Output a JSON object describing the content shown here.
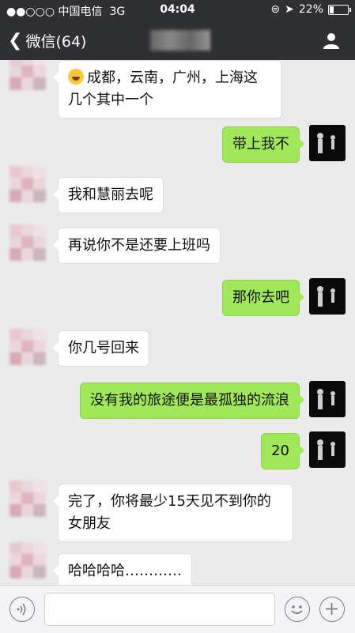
{
  "status_bar": {
    "carrier": "●●○○○ 中国电信",
    "network": "3G",
    "time": "04:04",
    "battery_percent": "22%",
    "battery_level": 0.22
  },
  "nav": {
    "back_label": "微信(64)"
  },
  "messages": [
    {
      "side": "left",
      "text": "成都，云南，广州，上海这\n几个其中一个",
      "emoji": "face-with-tears-of-joy"
    },
    {
      "side": "right",
      "text": "带上我不"
    },
    {
      "side": "left",
      "text": "我和慧丽去呢"
    },
    {
      "side": "left",
      "text": "再说你不是还要上班吗"
    },
    {
      "side": "right",
      "text": "那你去吧"
    },
    {
      "side": "left",
      "text": "你几号回来"
    },
    {
      "side": "right",
      "text": "没有我的旅途便是最孤独的流浪"
    },
    {
      "side": "right",
      "text": "20"
    },
    {
      "side": "left",
      "text": "完了，你将最少15天见不到你的\n女朋友"
    },
    {
      "side": "left",
      "text": "哈哈哈哈…………"
    }
  ],
  "input_bar": {
    "text": ""
  }
}
